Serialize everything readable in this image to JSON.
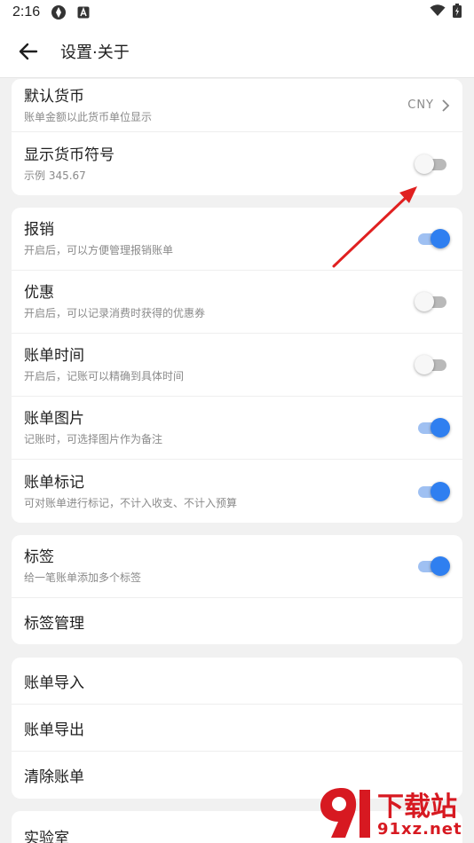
{
  "status_bar": {
    "time": "2:16"
  },
  "app_bar": {
    "title": "设置·关于"
  },
  "card1": {
    "currency": {
      "title": "默认货币",
      "subtitle": "账单金额以此货币单位显示",
      "value": "CNY"
    },
    "symbol": {
      "title": "显示货币符号",
      "subtitle": "示例 345.67",
      "enabled": false
    }
  },
  "card2": {
    "items": [
      {
        "title": "报销",
        "subtitle": "开启后，可以方便管理报销账单",
        "enabled": true
      },
      {
        "title": "优惠",
        "subtitle": "开启后，可以记录消费时获得的优惠券",
        "enabled": false
      },
      {
        "title": "账单时间",
        "subtitle": "开启后，记账可以精确到具体时间",
        "enabled": false
      },
      {
        "title": "账单图片",
        "subtitle": "记账时，可选择图片作为备注",
        "enabled": true
      },
      {
        "title": "账单标记",
        "subtitle": "可对账单进行标记，不计入收支、不计入预算",
        "enabled": true
      }
    ]
  },
  "card3": {
    "tags": {
      "title": "标签",
      "subtitle": "给一笔账单添加多个标签",
      "enabled": true
    },
    "tag_manage": "标签管理"
  },
  "card4": {
    "import": "账单导入",
    "export": "账单导出",
    "clear": "清除账单"
  },
  "card5": {
    "lab": "实验室"
  },
  "watermark": {
    "line1": "下载站",
    "line2": "91xz.net"
  },
  "colors": {
    "accent": "#2f7ff0",
    "annotation_arrow": "#e02020"
  }
}
